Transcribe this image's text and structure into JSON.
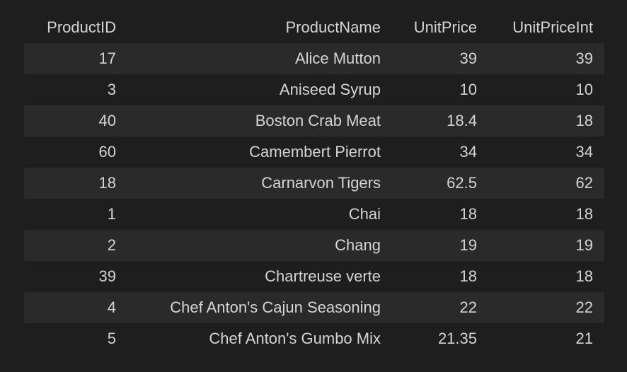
{
  "table": {
    "columns": [
      "ProductID",
      "ProductName",
      "UnitPrice",
      "UnitPriceInt"
    ],
    "rows": [
      [
        "17",
        "Alice Mutton",
        "39",
        "39"
      ],
      [
        "3",
        "Aniseed Syrup",
        "10",
        "10"
      ],
      [
        "40",
        "Boston Crab Meat",
        "18.4",
        "18"
      ],
      [
        "60",
        "Camembert Pierrot",
        "34",
        "34"
      ],
      [
        "18",
        "Carnarvon Tigers",
        "62.5",
        "62"
      ],
      [
        "1",
        "Chai",
        "18",
        "18"
      ],
      [
        "2",
        "Chang",
        "19",
        "19"
      ],
      [
        "39",
        "Chartreuse verte",
        "18",
        "18"
      ],
      [
        "4",
        "Chef Anton's Cajun Seasoning",
        "22",
        "22"
      ],
      [
        "5",
        "Chef Anton's Gumbo Mix",
        "21.35",
        "21"
      ]
    ]
  }
}
